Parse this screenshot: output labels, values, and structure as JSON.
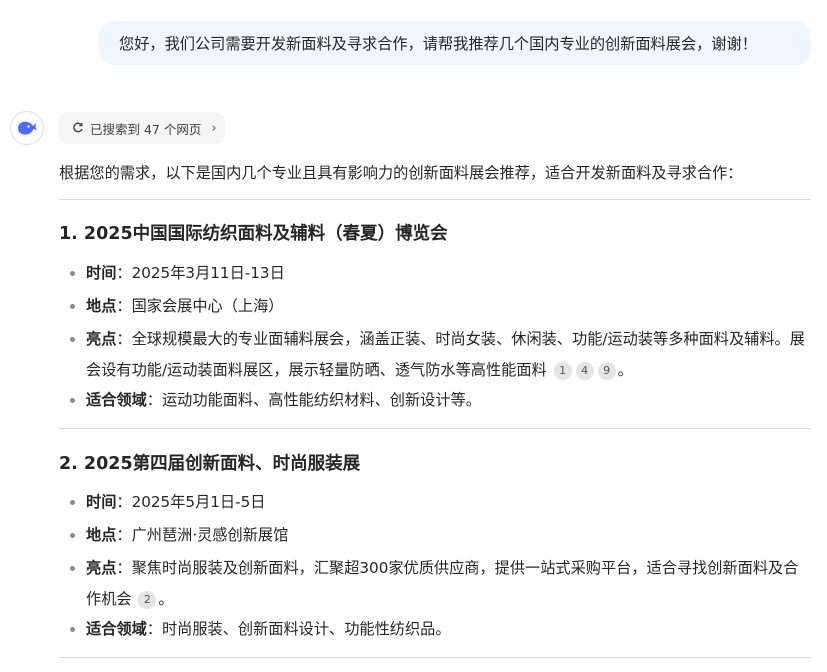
{
  "user_message": "您好，我们公司需要开发新面料及寻求合作，请帮我推荐几个国内专业的创新面料展会，谢谢！",
  "search_chip": {
    "label": "已搜索到 47 个网页",
    "chevron": "›"
  },
  "intro": "根据您的需求，以下是国内几个专业且具有影响力的创新面料展会推荐，适合开发新面料及寻求合作：",
  "colon": "：",
  "period": "。",
  "sections": [
    {
      "title": "1. 2025中国国际纺织面料及辅料（春夏）博览会",
      "time_label": "时间",
      "time_value": "2025年3月11日-13日",
      "place_label": "地点",
      "place_value": "国家会展中心（上海）",
      "highlight_label": "亮点",
      "highlight_value": "全球规模最大的专业面辅料展会，涵盖正装、时尚女装、休闲装、功能/运动装等多种面料及辅料。展会设有功能/运动装面料展区，展示轻量防晒、透气防水等高性能面料",
      "citations": [
        "1",
        "4",
        "9"
      ],
      "field_label": "适合领域",
      "field_value": "运动功能面料、高性能纺织材料、创新设计等。"
    },
    {
      "title": "2. 2025第四届创新面料、时尚服装展",
      "time_label": "时间",
      "time_value": "2025年5月1日-5日",
      "place_label": "地点",
      "place_value": "广州琶洲·灵感创新展馆",
      "highlight_label": "亮点",
      "highlight_value": "聚焦时尚服装及创新面料，汇聚超300家优质供应商，提供一站式采购平台，适合寻找创新面料及合作机会",
      "citations": [
        "2"
      ],
      "field_label": "适合领域",
      "field_value": "时尚服装、创新面料设计、功能性纺织品。"
    }
  ],
  "icons": {
    "avatar": "whale-logo-icon",
    "search": "search-refresh-icon"
  },
  "colors": {
    "bubble": "#eff6ff",
    "brand": "#4d6bfe",
    "divider": "#d9d9d9"
  }
}
